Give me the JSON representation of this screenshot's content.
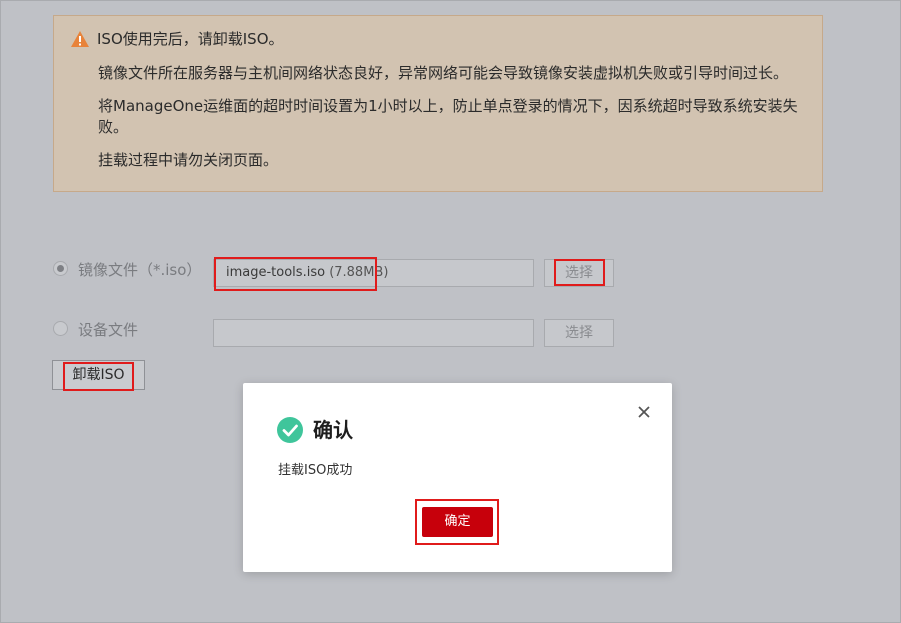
{
  "warning": {
    "lines": [
      "ISO使用完后，请卸载ISO。",
      "镜像文件所在服务器与主机间网络状态良好，异常网络可能会导致镜像安装虚拟机失败或引导时间过长。",
      "将ManageOne运维面的超时时间设置为1小时以上，防止单点登录的情况下，因系统超时导致系统安装失",
      "败。",
      "挂载过程中请勿关闭页面。"
    ],
    "accent_color": "#e8833a"
  },
  "form": {
    "image_option": {
      "label": "镜像文件（*.iso）",
      "selected": true,
      "file_name": "image-tools.iso",
      "file_size": "(7.88MB)",
      "choose_label": "选择"
    },
    "device_option": {
      "label": "设备文件",
      "selected": false,
      "file_name": "",
      "choose_label": "选择"
    },
    "unmount_label": "卸载ISO"
  },
  "dialog": {
    "title": "确认",
    "message": "挂载ISO成功",
    "confirm_label": "确定",
    "success_color": "#3fc59b",
    "confirm_color": "#c7000b"
  },
  "highlight_color": "#e01b1b"
}
